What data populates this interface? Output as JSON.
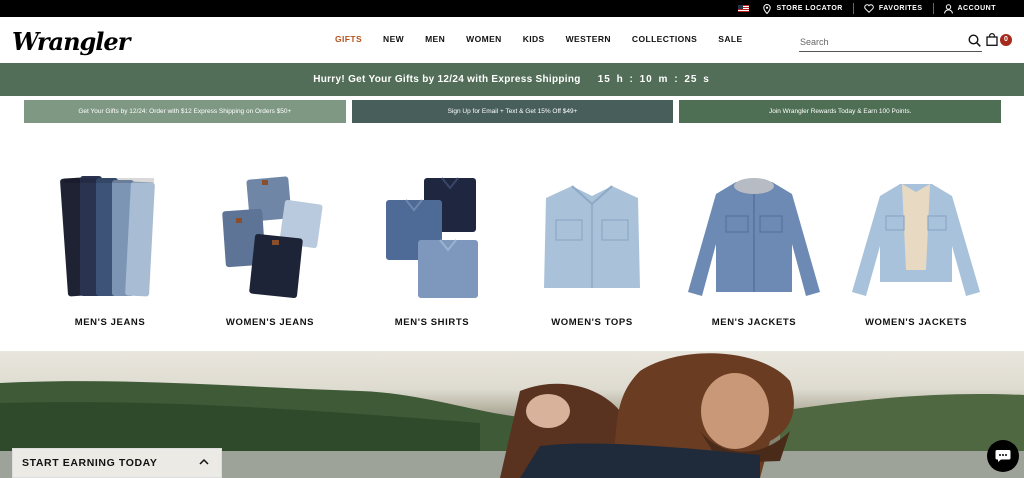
{
  "utility": {
    "store_locator": "STORE LOCATOR",
    "favorites": "FAVORITES",
    "account": "ACCOUNT"
  },
  "header": {
    "logo": "Wrangler",
    "nav": [
      "GIFTS",
      "NEW",
      "MEN",
      "WOMEN",
      "KIDS",
      "WESTERN",
      "COLLECTIONS",
      "SALE"
    ],
    "search_placeholder": "Search",
    "cart_count": "0"
  },
  "promo": {
    "text": "Hurry! Get Your Gifts by 12/24 with Express Shipping",
    "hours": "15",
    "h_label": "h",
    "minutes": "10",
    "m_label": "m",
    "seconds": "25",
    "s_label": "s",
    "colon": ":"
  },
  "boxes": [
    "Get Your Gifts by 12/24: Order with $12 Express Shipping on Orders $50+",
    "Sign Up for Email + Text & Get 15% Off $49+",
    "Join Wrangler Rewards Today & Earn 100 Points."
  ],
  "categories": [
    "MEN'S JEANS",
    "WOMEN'S JEANS",
    "MEN'S SHIRTS",
    "WOMEN'S TOPS",
    "MEN'S JACKETS",
    "WOMEN'S JACKETS"
  ],
  "earn": {
    "label": "START EARNING TODAY"
  },
  "colors": {
    "accent": "#b5511d",
    "promo_green": "#536e58",
    "cart_badge": "#a62a1c"
  }
}
